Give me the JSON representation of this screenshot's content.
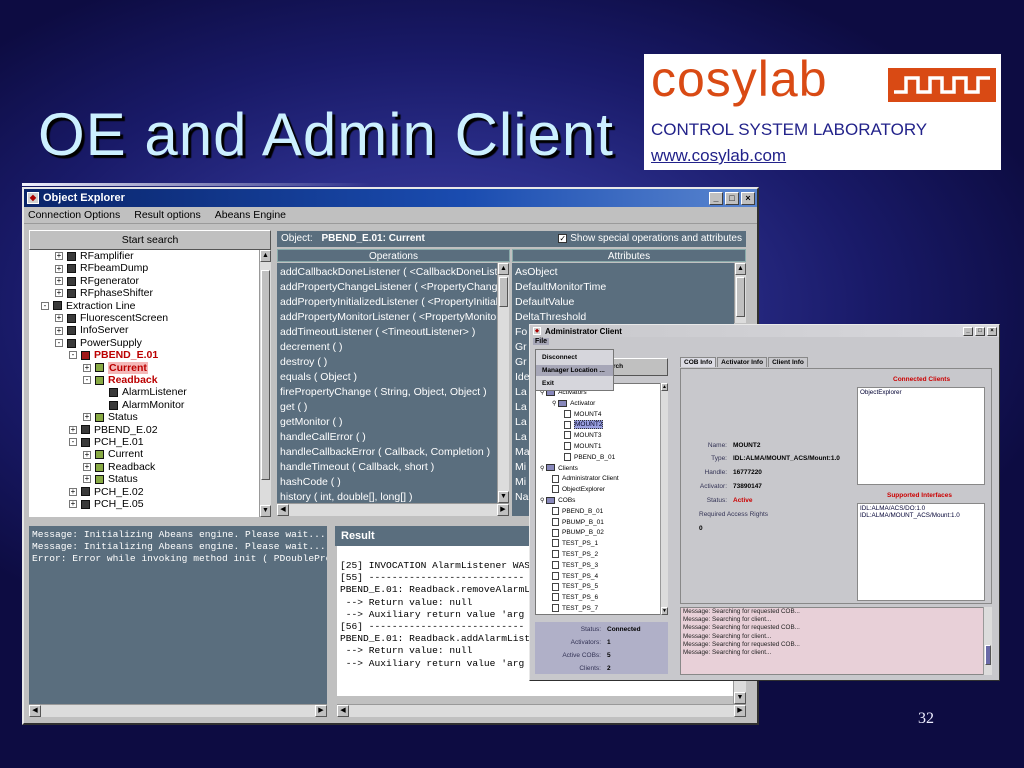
{
  "slide": {
    "title": "OE and Admin Client",
    "page_number": "32",
    "logo": {
      "word": "cosylab",
      "subtitle": "CONTROL SYSTEM LABORATORY",
      "url": "www.cosylab.com"
    }
  },
  "colors": {
    "accent": "#d94a14",
    "panel": "#5a6e7e",
    "titlebar": "#0a246a"
  },
  "object_explorer": {
    "title": "Object Explorer",
    "menu": [
      "Connection Options",
      "Result options",
      "Abeans Engine"
    ],
    "start_search": "Start search",
    "object_label": "Object:",
    "object_value": "PBEND_E.01: Current",
    "show_special": "Show special operations and attributes",
    "operations_header": "Operations",
    "attributes_header": "Attributes",
    "tree": [
      {
        "label": "RFamplifier",
        "indent": 0,
        "toggle": "+"
      },
      {
        "label": "RFbeamDump",
        "indent": 0,
        "toggle": "+"
      },
      {
        "label": "RFgenerator",
        "indent": 0,
        "toggle": "+"
      },
      {
        "label": "RFphaseShifter",
        "indent": 0,
        "toggle": "+"
      },
      {
        "label": "Extraction Line",
        "indent": -1,
        "toggle": "-"
      },
      {
        "label": "FluorescentScreen",
        "indent": 0,
        "toggle": "+"
      },
      {
        "label": "InfoServer",
        "indent": 0,
        "toggle": "+"
      },
      {
        "label": "PowerSupply",
        "indent": 0,
        "toggle": "-"
      },
      {
        "label": "PBEND_E.01",
        "indent": 1,
        "toggle": "-"
      },
      {
        "label": "Current",
        "indent": 2,
        "toggle": "+"
      },
      {
        "label": "Readback",
        "indent": 2,
        "toggle": "-"
      },
      {
        "label": "AlarmListener",
        "indent": 3,
        "toggle": ""
      },
      {
        "label": "AlarmMonitor",
        "indent": 3,
        "toggle": ""
      },
      {
        "label": "Status",
        "indent": 2,
        "toggle": "+"
      },
      {
        "label": "PBEND_E.02",
        "indent": 1,
        "toggle": "+"
      },
      {
        "label": "PCH_E.01",
        "indent": 1,
        "toggle": "-"
      },
      {
        "label": "Current",
        "indent": 2,
        "toggle": "+"
      },
      {
        "label": "Readback",
        "indent": 2,
        "toggle": "+"
      },
      {
        "label": "Status",
        "indent": 2,
        "toggle": "+"
      },
      {
        "label": "PCH_E.02",
        "indent": 1,
        "toggle": "+"
      },
      {
        "label": "PCH_E.05",
        "indent": 1,
        "toggle": "+"
      }
    ],
    "operations": [
      "addCallbackDoneListener ( <CallbackDoneListen",
      "addPropertyChangeListener ( <PropertyChangeLi",
      "addPropertyInitializedListener ( <PropertyInitialize",
      "addPropertyMonitorListener ( <PropertyMonitorList",
      "addTimeoutListener ( <TimeoutListener> )",
      "decrement ( )",
      "destroy ( )",
      "equals ( Object )",
      "firePropertyChange ( String, Object, Object )",
      "get ( )",
      "getMonitor ( )",
      "handleCallError ( )",
      "handleCallbackError ( Callback, Completion )",
      "handleTimeout ( Callback, short )",
      "hashCode ( )",
      "history ( int, double[], long[] )"
    ],
    "attributes": [
      "AsObject",
      "DefaultMonitorTime",
      "DefaultValue",
      "DeltaThreshold",
      "Fo",
      "Gr",
      "Gr",
      "Ide",
      "La",
      "La",
      "La",
      "La",
      "Ma",
      "Mi",
      "Mi",
      "Na"
    ],
    "console": [
      "Message: Initializing Abeans engine. Please wait...",
      "Message: Initializing Abeans engine. Please wait...",
      "Error: Error while invoking method init ( PDoubleProx"
    ],
    "result_header": "Result",
    "result": [
      "[25] INVOCATION AlarmListener WAS I",
      "[55] ---------------------------",
      "PBEND_E.01: Readback.removeAlarmLis",
      " --> Return value: null",
      " --> Auxiliary return value 'arg 1'",
      "[56] ---------------------------",
      "PBEND_E.01: Readback.addAlarmListen",
      " --> Return value: null",
      " --> Auxiliary return value 'arg 1'"
    ]
  },
  "admin_client": {
    "title": "Administrator Client",
    "menu_file": "File",
    "file_menu": [
      "Disconnect",
      "Manager Location ...",
      "Exit"
    ],
    "search_button_tail": "rch",
    "tree": [
      {
        "label": "Activators",
        "type": "folder",
        "indent": 0
      },
      {
        "label": "Activator",
        "type": "folder",
        "indent": 1
      },
      {
        "label": "MOUNT4",
        "type": "doc",
        "indent": 2
      },
      {
        "label": "MOUNT2",
        "type": "doc",
        "indent": 2,
        "selected": true
      },
      {
        "label": "MOUNT3",
        "type": "doc",
        "indent": 2
      },
      {
        "label": "MOUNT1",
        "type": "doc",
        "indent": 2
      },
      {
        "label": "PBEND_B_01",
        "type": "doc",
        "indent": 2
      },
      {
        "label": "Clients",
        "type": "folder",
        "indent": 0
      },
      {
        "label": "Administrator Client",
        "type": "doc",
        "indent": 1
      },
      {
        "label": "ObjectExplorer",
        "type": "doc",
        "indent": 1
      },
      {
        "label": "COBs",
        "type": "folder",
        "indent": 0
      },
      {
        "label": "PBEND_B_01",
        "type": "doc",
        "indent": 1
      },
      {
        "label": "PBUMP_B_01",
        "type": "doc",
        "indent": 1
      },
      {
        "label": "PBUMP_B_02",
        "type": "doc",
        "indent": 1
      },
      {
        "label": "TEST_PS_1",
        "type": "doc",
        "indent": 1
      },
      {
        "label": "TEST_PS_2",
        "type": "doc",
        "indent": 1
      },
      {
        "label": "TEST_PS_3",
        "type": "doc",
        "indent": 1
      },
      {
        "label": "TEST_PS_4",
        "type": "doc",
        "indent": 1
      },
      {
        "label": "TEST_PS_5",
        "type": "doc",
        "indent": 1
      },
      {
        "label": "TEST_PS_6",
        "type": "doc",
        "indent": 1
      },
      {
        "label": "TEST_PS_7",
        "type": "doc",
        "indent": 1
      }
    ],
    "status_panel": {
      "status_label": "Status:",
      "status_value": "Connected",
      "activators_label": "Activators:",
      "activators_value": "1",
      "active_cobs_label": "Active COBs:",
      "active_cobs_value": "5",
      "clients_label": "Clients:",
      "clients_value": "2"
    },
    "tabs": [
      "COB Info",
      "Activator Info",
      "Client Info"
    ],
    "connected_clients_label": "Connected Clients",
    "connected_clients": [
      "ObjectExplorer"
    ],
    "details": {
      "name_label": "Name:",
      "name_value": "MOUNT2",
      "type_label": "Type:",
      "type_value": "IDL:ALMA/MOUNT_ACS/Mount:1.0",
      "handle_label": "Handle:",
      "handle_value": "16777220",
      "activator_label": "Activator:",
      "activator_value": "73890147",
      "status_label": "Status:",
      "status_value": "Active",
      "rights_label": "Required Access Rights",
      "rights_value": "0"
    },
    "supported_interfaces_label": "Supported Interfaces",
    "supported_interfaces": [
      "IDL:ALMA/ACS/DO:1.0",
      "IDL:ALMA/MOUNT_ACS/Mount:1.0"
    ],
    "log": [
      "Message: Searching for requested COB...",
      "Message: Searching for client...",
      "Message: Searching for requested COB...",
      "Message: Searching for client...",
      "Message: Searching for requested COB...",
      "Message: Searching for client..."
    ]
  }
}
